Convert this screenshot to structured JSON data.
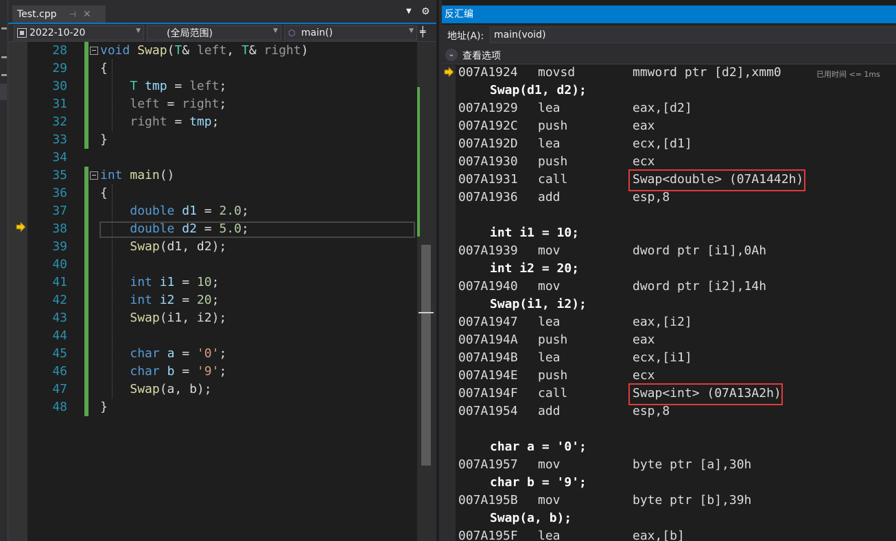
{
  "editor": {
    "tab": {
      "filename": "Test.cpp",
      "pin_glyph": "⊣",
      "close_glyph": "✕"
    },
    "tab_dropdown_glyph": "▼",
    "tab_settings_glyph": "⚙",
    "nav": {
      "project": "2022-10-20",
      "scope": "(全局范围)",
      "function": "main()",
      "split_glyph": "╪"
    },
    "current_line": 38,
    "lines": [
      {
        "num": "28",
        "tokens": [
          {
            "t": "void",
            "c": "kw"
          },
          {
            "t": " ",
            "c": "pl"
          },
          {
            "t": "Swap",
            "c": "fn"
          },
          {
            "t": "(",
            "c": "pl"
          },
          {
            "t": "T",
            "c": "ty"
          },
          {
            "t": "& ",
            "c": "pl"
          },
          {
            "t": "left",
            "c": "par"
          },
          {
            "t": ", ",
            "c": "pl"
          },
          {
            "t": "T",
            "c": "ty"
          },
          {
            "t": "& ",
            "c": "pl"
          },
          {
            "t": "right",
            "c": "par"
          },
          {
            "t": ")",
            "c": "pl"
          }
        ]
      },
      {
        "num": "29",
        "tokens": [
          {
            "t": "{",
            "c": "pl"
          }
        ]
      },
      {
        "num": "30",
        "tokens": [
          {
            "t": "    ",
            "c": "pl"
          },
          {
            "t": "T",
            "c": "ty"
          },
          {
            "t": " ",
            "c": "pl"
          },
          {
            "t": "tmp",
            "c": "loc"
          },
          {
            "t": " = ",
            "c": "pl"
          },
          {
            "t": "left",
            "c": "par"
          },
          {
            "t": ";",
            "c": "pl"
          }
        ]
      },
      {
        "num": "31",
        "tokens": [
          {
            "t": "    ",
            "c": "pl"
          },
          {
            "t": "left",
            "c": "par"
          },
          {
            "t": " = ",
            "c": "pl"
          },
          {
            "t": "right",
            "c": "par"
          },
          {
            "t": ";",
            "c": "pl"
          }
        ]
      },
      {
        "num": "32",
        "tokens": [
          {
            "t": "    ",
            "c": "pl"
          },
          {
            "t": "right",
            "c": "par"
          },
          {
            "t": " = ",
            "c": "pl"
          },
          {
            "t": "tmp",
            "c": "loc"
          },
          {
            "t": ";",
            "c": "pl"
          }
        ]
      },
      {
        "num": "33",
        "tokens": [
          {
            "t": "}",
            "c": "pl"
          }
        ]
      },
      {
        "num": "34",
        "tokens": []
      },
      {
        "num": "35",
        "tokens": [
          {
            "t": "int",
            "c": "kw"
          },
          {
            "t": " ",
            "c": "pl"
          },
          {
            "t": "main",
            "c": "fn"
          },
          {
            "t": "()",
            "c": "pl"
          }
        ]
      },
      {
        "num": "36",
        "tokens": [
          {
            "t": "{",
            "c": "pl"
          }
        ]
      },
      {
        "num": "37",
        "tokens": [
          {
            "t": "    ",
            "c": "pl"
          },
          {
            "t": "double",
            "c": "kw"
          },
          {
            "t": " ",
            "c": "pl"
          },
          {
            "t": "d1",
            "c": "loc"
          },
          {
            "t": " = ",
            "c": "pl"
          },
          {
            "t": "2.0",
            "c": "num"
          },
          {
            "t": ";",
            "c": "pl"
          }
        ]
      },
      {
        "num": "38",
        "tokens": [
          {
            "t": "    ",
            "c": "pl"
          },
          {
            "t": "double",
            "c": "kw"
          },
          {
            "t": " ",
            "c": "pl"
          },
          {
            "t": "d2",
            "c": "loc"
          },
          {
            "t": " = ",
            "c": "pl"
          },
          {
            "t": "5.0",
            "c": "num"
          },
          {
            "t": ";",
            "c": "pl"
          }
        ]
      },
      {
        "num": "39",
        "tokens": [
          {
            "t": "    ",
            "c": "pl"
          },
          {
            "t": "Swap",
            "c": "fn"
          },
          {
            "t": "(d1, d2);",
            "c": "pl"
          }
        ]
      },
      {
        "num": "40",
        "tokens": []
      },
      {
        "num": "41",
        "tokens": [
          {
            "t": "    ",
            "c": "pl"
          },
          {
            "t": "int",
            "c": "kw"
          },
          {
            "t": " ",
            "c": "pl"
          },
          {
            "t": "i1",
            "c": "loc"
          },
          {
            "t": " = ",
            "c": "pl"
          },
          {
            "t": "10",
            "c": "num"
          },
          {
            "t": ";",
            "c": "pl"
          }
        ]
      },
      {
        "num": "42",
        "tokens": [
          {
            "t": "    ",
            "c": "pl"
          },
          {
            "t": "int",
            "c": "kw"
          },
          {
            "t": " ",
            "c": "pl"
          },
          {
            "t": "i2",
            "c": "loc"
          },
          {
            "t": " = ",
            "c": "pl"
          },
          {
            "t": "20",
            "c": "num"
          },
          {
            "t": ";",
            "c": "pl"
          }
        ]
      },
      {
        "num": "43",
        "tokens": [
          {
            "t": "    ",
            "c": "pl"
          },
          {
            "t": "Swap",
            "c": "fn"
          },
          {
            "t": "(i1, i2);",
            "c": "pl"
          }
        ]
      },
      {
        "num": "44",
        "tokens": []
      },
      {
        "num": "45",
        "tokens": [
          {
            "t": "    ",
            "c": "pl"
          },
          {
            "t": "char",
            "c": "kw"
          },
          {
            "t": " ",
            "c": "pl"
          },
          {
            "t": "a",
            "c": "loc"
          },
          {
            "t": " = ",
            "c": "pl"
          },
          {
            "t": "'0'",
            "c": "str"
          },
          {
            "t": ";",
            "c": "pl"
          }
        ]
      },
      {
        "num": "46",
        "tokens": [
          {
            "t": "    ",
            "c": "pl"
          },
          {
            "t": "char",
            "c": "kw"
          },
          {
            "t": " ",
            "c": "pl"
          },
          {
            "t": "b",
            "c": "loc"
          },
          {
            "t": " = ",
            "c": "pl"
          },
          {
            "t": "'9'",
            "c": "str"
          },
          {
            "t": ";",
            "c": "pl"
          }
        ]
      },
      {
        "num": "47",
        "tokens": [
          {
            "t": "    ",
            "c": "pl"
          },
          {
            "t": "Swap",
            "c": "fn"
          },
          {
            "t": "(a, b);",
            "c": "pl"
          }
        ]
      },
      {
        "num": "48",
        "tokens": [
          {
            "t": "}",
            "c": "pl"
          }
        ]
      }
    ]
  },
  "disasm": {
    "title": "反汇编",
    "address_label": "地址(A):",
    "address_value": "main(void)",
    "options_label": "查看选项",
    "options_glyph": "⌄",
    "elapsed": "已用时间 <= 1ms",
    "lines": [
      {
        "kind": "asm",
        "addr": "007A1924",
        "op": "movsd",
        "arg": "mmword ptr [d2],xmm0"
      },
      {
        "kind": "src",
        "text": "Swap(d1, d2);"
      },
      {
        "kind": "asm",
        "addr": "007A1929",
        "op": "lea",
        "arg": "eax,[d2]"
      },
      {
        "kind": "asm",
        "addr": "007A192C",
        "op": "push",
        "arg": "eax"
      },
      {
        "kind": "asm",
        "addr": "007A192D",
        "op": "lea",
        "arg": "ecx,[d1]"
      },
      {
        "kind": "asm",
        "addr": "007A1930",
        "op": "push",
        "arg": "ecx"
      },
      {
        "kind": "asm",
        "addr": "007A1931",
        "op": "call",
        "arg": "Swap<double> (07A1442h)",
        "highlight": true
      },
      {
        "kind": "asm",
        "addr": "007A1936",
        "op": "add",
        "arg": "esp,8"
      },
      {
        "kind": "blank"
      },
      {
        "kind": "src",
        "text": "int i1 = 10;"
      },
      {
        "kind": "asm",
        "addr": "007A1939",
        "op": "mov",
        "arg": "dword ptr [i1],0Ah"
      },
      {
        "kind": "src",
        "text": "int i2 = 20;"
      },
      {
        "kind": "asm",
        "addr": "007A1940",
        "op": "mov",
        "arg": "dword ptr [i2],14h"
      },
      {
        "kind": "src",
        "text": "Swap(i1, i2);"
      },
      {
        "kind": "asm",
        "addr": "007A1947",
        "op": "lea",
        "arg": "eax,[i2]"
      },
      {
        "kind": "asm",
        "addr": "007A194A",
        "op": "push",
        "arg": "eax"
      },
      {
        "kind": "asm",
        "addr": "007A194B",
        "op": "lea",
        "arg": "ecx,[i1]"
      },
      {
        "kind": "asm",
        "addr": "007A194E",
        "op": "push",
        "arg": "ecx"
      },
      {
        "kind": "asm",
        "addr": "007A194F",
        "op": "call",
        "arg": "Swap<int> (07A13A2h)",
        "highlight": true
      },
      {
        "kind": "asm",
        "addr": "007A1954",
        "op": "add",
        "arg": "esp,8"
      },
      {
        "kind": "blank"
      },
      {
        "kind": "src",
        "text": "char a = '0';"
      },
      {
        "kind": "asm",
        "addr": "007A1957",
        "op": "mov",
        "arg": "byte ptr [a],30h"
      },
      {
        "kind": "src",
        "text": "char b = '9';"
      },
      {
        "kind": "asm",
        "addr": "007A195B",
        "op": "mov",
        "arg": "byte ptr [b],39h"
      },
      {
        "kind": "src",
        "text": "Swap(a, b);"
      },
      {
        "kind": "asm",
        "addr": "007A195F",
        "op": "lea",
        "arg": "eax,[b]"
      }
    ]
  }
}
